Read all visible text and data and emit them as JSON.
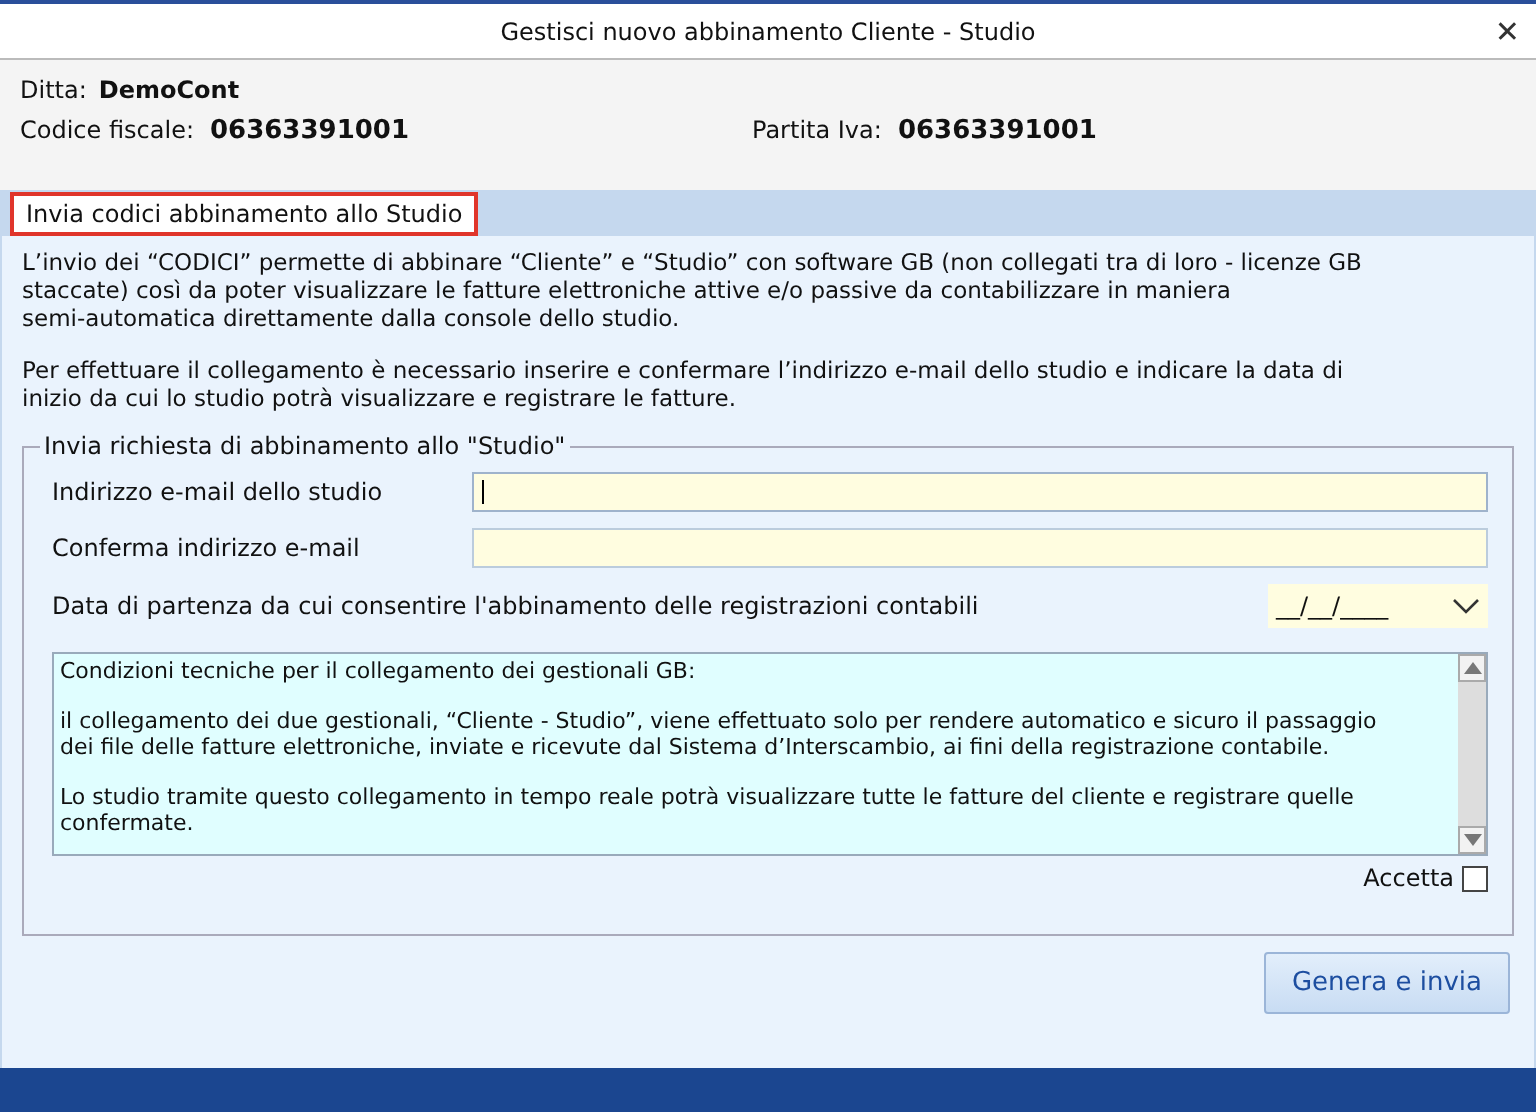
{
  "window": {
    "title": "Gestisci nuovo abbinamento Cliente - Studio",
    "close": "✕"
  },
  "header": {
    "ditta_label": "Ditta:",
    "ditta": "DemoCont",
    "cf_label": "Codice fiscale:",
    "cf": "06363391001",
    "piva_label": "Partita Iva:",
    "piva": "06363391001"
  },
  "tab": {
    "label": "Invia codici abbinamento allo Studio",
    "selected": true
  },
  "intro": [
    "L’invio dei “CODICI” permette di abbinare “Cliente” e “Studio” con software GB (non collegati tra di loro - licenze GB\nstaccate) così da poter visualizzare le fatture elettroniche attive e/o passive da contabilizzare in maniera\nsemi-automatica direttamente dalla console dello studio.",
    "Per effettuare il collegamento è necessario inserire e confermare l’indirizzo e-mail dello studio e indicare la data di\ninizio da cui lo studio potrà visualizzare e registrare le fatture."
  ],
  "group": {
    "title": "Invia richiesta di abbinamento allo \"Studio\"",
    "fields": [
      {
        "label": "Indirizzo e-mail dello studio",
        "kind": "text",
        "focused": true
      },
      {
        "label": "Conferma indirizzo e-mail",
        "kind": "text",
        "focused": false
      },
      {
        "label": "Data di partenza da cui consentire l'abbinamento delle registrazioni contabili",
        "kind": "date",
        "value": "__/__/____"
      }
    ],
    "conditions": [
      "Condizioni tecniche per il collegamento dei gestionali GB:",
      "il collegamento dei due gestionali, “Cliente - Studio”, viene effettuato solo per rendere automatico e sicuro il passaggio\ndei file delle fatture elettroniche, inviate e ricevute dal Sistema d’Interscambio, ai fini della registrazione contabile.",
      "Lo studio tramite questo collegamento in tempo reale potrà visualizzare tutte le fatture del cliente e registrare quelle\nconfermate."
    ],
    "accept": {
      "label": "Accetta",
      "checked": false
    }
  },
  "button": "Genera e invia"
}
